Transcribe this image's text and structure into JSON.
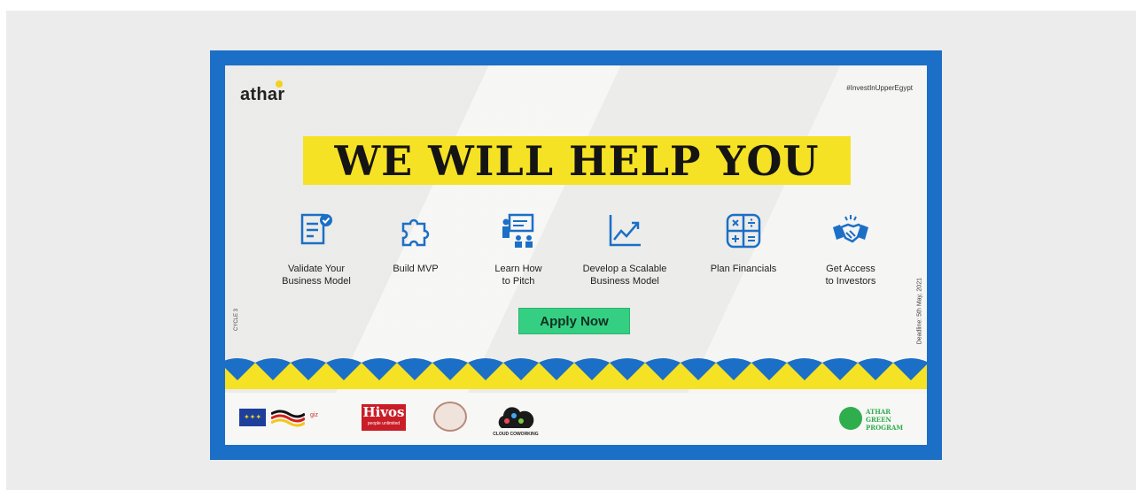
{
  "poster": {
    "logo": "athar",
    "hashtag": "#InvestInUpperEgypt",
    "headline": "WE WILL HELP YOU",
    "services": [
      {
        "line1": "Validate Your",
        "line2": "Business Model",
        "icon": "document-check-icon"
      },
      {
        "line1": "Build MVP",
        "line2": "",
        "icon": "puzzle-icon"
      },
      {
        "line1": "Learn How",
        "line2": "to Pitch",
        "icon": "presentation-icon"
      },
      {
        "line1": "Develop a Scalable",
        "line2": "Business Model",
        "icon": "growth-chart-icon"
      },
      {
        "line1": "Plan Financials",
        "line2": "",
        "icon": "calculator-icon"
      },
      {
        "line1": "Get Access",
        "line2": "to Investors",
        "icon": "handshake-icon"
      }
    ],
    "apply_label": "Apply Now",
    "cycle_label": "CYCLE 3",
    "deadline": "Deadline: 5th May, 2021",
    "colors": {
      "frame": "#1b6fc6",
      "highlight": "#f6e224",
      "apply": "#35cf84",
      "brand_green": "#2fae4e"
    }
  },
  "partners": {
    "hivos_title": "Hivos",
    "hivos_sub": "people unlimited",
    "cloud_name": "CLOUD COWORKING",
    "program_lines": [
      "ATHAR",
      "GREEN",
      "PROGRAM"
    ]
  }
}
